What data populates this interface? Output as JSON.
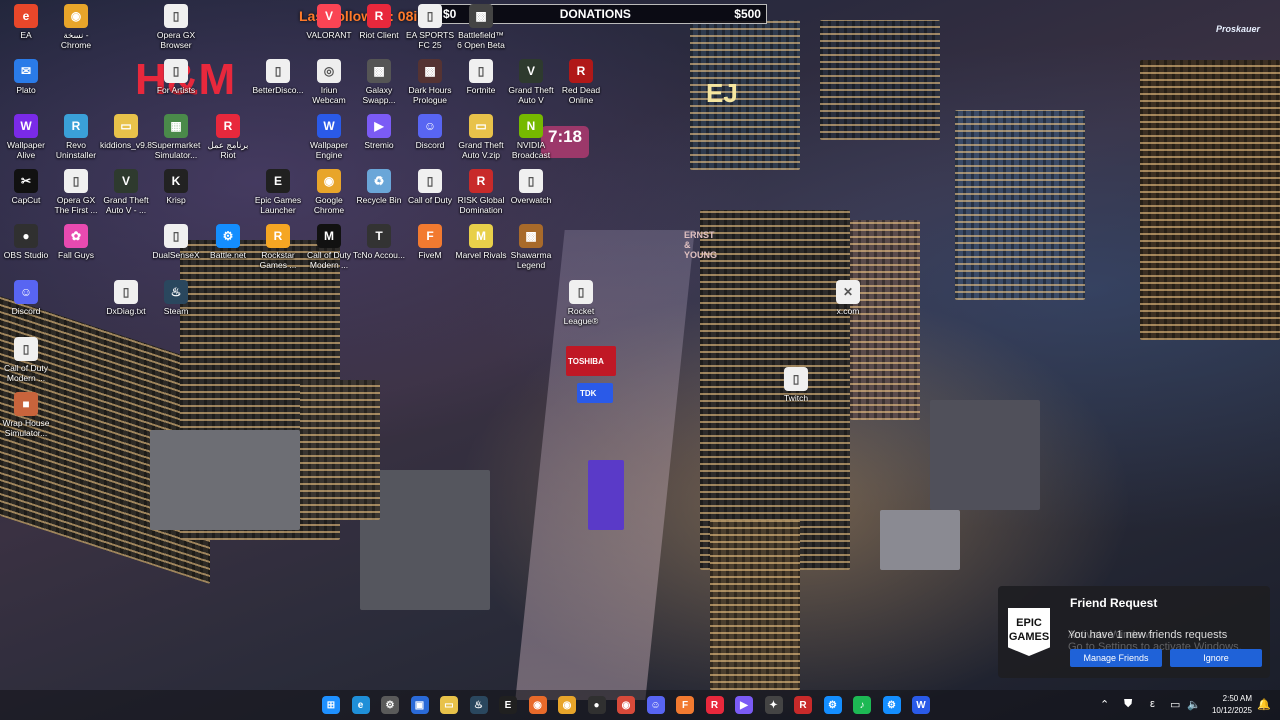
{
  "overlay": {
    "follower_text": "Last follower : 08ir",
    "donations_left": "$0",
    "donations_title": "DONATIONS",
    "donations_right": "$500",
    "clock_widget_time": "7:18",
    "brand_sign": "Proskauer"
  },
  "desktop_icons": [
    {
      "label": "EA",
      "glyph": "e",
      "color": "#e8472a"
    },
    {
      "label": "Plato",
      "glyph": "✉",
      "color": "#2a7be8"
    },
    {
      "label": "Wallpaper Alive",
      "glyph": "W",
      "color": "#7a2ae8"
    },
    {
      "label": "CapCut",
      "glyph": "✂",
      "color": "#111111"
    },
    {
      "label": "OBS Studio",
      "glyph": "●",
      "color": "#303030"
    },
    {
      "label": "Discord",
      "glyph": "☺",
      "color": "#5865f2"
    },
    {
      "label": "Call of Duty Modern ...",
      "glyph": "▯",
      "color": "#f0f0f0"
    },
    {
      "label": "Wrap House Simulator...",
      "glyph": "■",
      "color": "#c8643c"
    },
    {
      "label": "نسخة - Chrome",
      "glyph": "◉",
      "color": "#e8a52a"
    },
    {
      "label": "For Artists",
      "glyph": "▯",
      "color": "#f0f0f0"
    },
    {
      "label": "Revo Uninstaller",
      "glyph": "R",
      "color": "#3aa0d8"
    },
    {
      "label": "Opera GX The First ...",
      "glyph": "▯",
      "color": "#f0f0f0"
    },
    {
      "label": "Fall Guys",
      "glyph": "✿",
      "color": "#e84ab0"
    },
    {
      "label": "DxDiag.txt",
      "glyph": "▯",
      "color": "#f0f0f0"
    },
    {
      "label": "kiddions_v9.8",
      "glyph": "▭",
      "color": "#e8c24a"
    },
    {
      "label": "Grand Theft Auto V - ...",
      "glyph": "V",
      "color": "#2e3a2e"
    },
    {
      "label": "Opera GX Browser",
      "glyph": "▯",
      "color": "#f0f0f0"
    },
    {
      "label": "Supermarket Simulator...",
      "glyph": "▦",
      "color": "#4a8a4a"
    },
    {
      "label": "Krisp",
      "glyph": "K",
      "color": "#222222"
    },
    {
      "label": "DualSenseX",
      "glyph": "▯",
      "color": "#f0f0f0"
    },
    {
      "label": "Steam",
      "glyph": "♨",
      "color": "#2a475e"
    },
    {
      "label": "برنامج عمل Riot",
      "glyph": "R",
      "color": "#e8283c"
    },
    {
      "label": "Battle.net",
      "glyph": "⚙",
      "color": "#148eff"
    },
    {
      "label": "BetterDisco...",
      "glyph": "▯",
      "color": "#f0f0f0"
    },
    {
      "label": "Epic Games Launcher",
      "glyph": "E",
      "color": "#202020"
    },
    {
      "label": "Rockstar Games ...",
      "glyph": "R",
      "color": "#f5a623"
    },
    {
      "label": "VALORANT",
      "glyph": "V",
      "color": "#fa4454"
    },
    {
      "label": "Iriun Webcam",
      "glyph": "◎",
      "color": "#eeeeee"
    },
    {
      "label": "Wallpaper Engine",
      "glyph": "W",
      "color": "#2a5ae8"
    },
    {
      "label": "Google Chrome",
      "glyph": "◉",
      "color": "#e8a52a"
    },
    {
      "label": "Call of Duty Modern ...",
      "glyph": "M",
      "color": "#111111"
    },
    {
      "label": "Riot Client",
      "glyph": "R",
      "color": "#e8283c"
    },
    {
      "label": "Galaxy Swapp...",
      "glyph": "▩",
      "color": "#555555"
    },
    {
      "label": "Stremio",
      "glyph": "▶",
      "color": "#7b5bf5"
    },
    {
      "label": "Recycle Bin",
      "glyph": "♻",
      "color": "#6aa6d8"
    },
    {
      "label": "TcNo Accou...",
      "glyph": "T",
      "color": "#333333"
    },
    {
      "label": "EA SPORTS FC 25",
      "glyph": "▯",
      "color": "#f0f0f0"
    },
    {
      "label": "Dark Hours Prologue",
      "glyph": "▩",
      "color": "#553333"
    },
    {
      "label": "Discord",
      "glyph": "☺",
      "color": "#5865f2"
    },
    {
      "label": "Call of Duty",
      "glyph": "▯",
      "color": "#f0f0f0"
    },
    {
      "label": "FiveM",
      "glyph": "F",
      "color": "#f27a30"
    },
    {
      "label": "Battlefield™ 6 Open Beta",
      "glyph": "▩",
      "color": "#444444"
    },
    {
      "label": "Fortnite",
      "glyph": "▯",
      "color": "#f0f0f0"
    },
    {
      "label": "Grand Theft Auto V.zip",
      "glyph": "▭",
      "color": "#e8c24a"
    },
    {
      "label": "RISK Global Domination",
      "glyph": "R",
      "color": "#c82a2a"
    },
    {
      "label": "Marvel Rivals",
      "glyph": "M",
      "color": "#e8d04a"
    },
    {
      "label": "Grand Theft Auto V",
      "glyph": "V",
      "color": "#2e3a2e"
    },
    {
      "label": "NVIDIA Broadcast",
      "glyph": "N",
      "color": "#76b900"
    },
    {
      "label": "Overwatch",
      "glyph": "▯",
      "color": "#f0f0f0"
    },
    {
      "label": "Shawarma Legend",
      "glyph": "▩",
      "color": "#a86a2a"
    },
    {
      "label": "Red Dead Online",
      "glyph": "R",
      "color": "#b01818"
    },
    {
      "label": "Rocket League®",
      "glyph": "▯",
      "color": "#f0f0f0"
    },
    {
      "label": "x.com",
      "glyph": "✕",
      "color": "#f0f0f0"
    },
    {
      "label": "Twitch",
      "glyph": "▯",
      "color": "#f0f0f0"
    }
  ],
  "notification": {
    "app_logo": "EPIC GAMES",
    "title": "Friend Request",
    "message": "You have 1 new friends requests",
    "watermark_line1": "Activate Windows",
    "watermark_line2": "Go to Settings to activate Windows.",
    "primary_button": "Manage Friends",
    "secondary_button": "Ignore"
  },
  "taskbar": {
    "apps": [
      {
        "name": "start-button",
        "glyph": "⊞",
        "color": "#1e90ff"
      },
      {
        "name": "edge-app",
        "glyph": "e",
        "color": "#1f8fd8"
      },
      {
        "name": "settings-app",
        "glyph": "⚙",
        "color": "#5a5a5a"
      },
      {
        "name": "store-app",
        "glyph": "▣",
        "color": "#2a6ad8"
      },
      {
        "name": "explorer-app",
        "glyph": "▭",
        "color": "#e8c24a"
      },
      {
        "name": "steam-app",
        "glyph": "♨",
        "color": "#2a475e"
      },
      {
        "name": "epic-app",
        "glyph": "E",
        "color": "#202020"
      },
      {
        "name": "firefox-app",
        "glyph": "◉",
        "color": "#e86a2a"
      },
      {
        "name": "chrome-app",
        "glyph": "◉",
        "color": "#e8a52a"
      },
      {
        "name": "obs-app",
        "glyph": "●",
        "color": "#303030"
      },
      {
        "name": "chrome-app-2",
        "glyph": "◉",
        "color": "#d84a3a"
      },
      {
        "name": "discord-app",
        "glyph": "☺",
        "color": "#5865f2"
      },
      {
        "name": "fivem-app",
        "glyph": "F",
        "color": "#f27a30"
      },
      {
        "name": "riot-app",
        "glyph": "R",
        "color": "#e8283c"
      },
      {
        "name": "stremio-app",
        "glyph": "▶",
        "color": "#7b5bf5"
      },
      {
        "name": "overlay-app",
        "glyph": "✦",
        "color": "#444444"
      },
      {
        "name": "rockstar-app",
        "glyph": "R",
        "color": "#c82a2a"
      },
      {
        "name": "battlenet-app",
        "glyph": "⚙",
        "color": "#148eff"
      },
      {
        "name": "spotify-app",
        "glyph": "♪",
        "color": "#1db954"
      },
      {
        "name": "battlenet-app-2",
        "glyph": "⚙",
        "color": "#148eff"
      },
      {
        "name": "wallpaper-engine-app",
        "glyph": "W",
        "color": "#2a5ae8"
      }
    ],
    "time": "2:50 AM",
    "date": "10/12/2025"
  }
}
